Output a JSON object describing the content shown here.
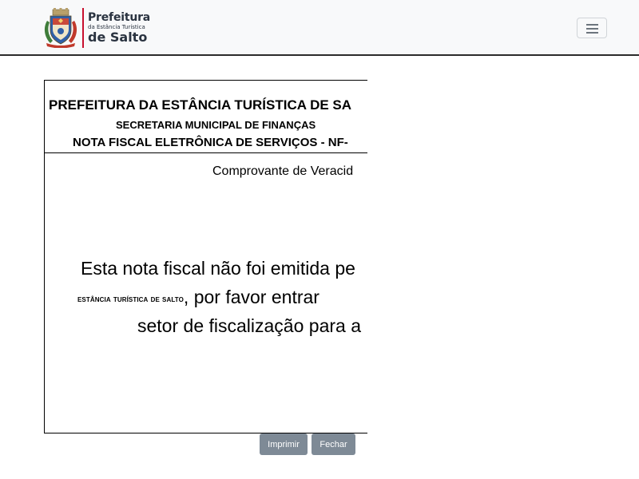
{
  "navbar": {
    "brand": {
      "line1": "Prefeitura",
      "line2": "da Estância Turística",
      "line3": "de Salto"
    },
    "toggler_icon": "hamburger-icon"
  },
  "document": {
    "header_title": "PREFEITURA DA ESTÂNCIA TURÍSTICA DE SA",
    "header_subtitle": "SECRETARIA MUNICIPAL DE FINANÇAS",
    "header_doc_type": "NOTA FISCAL ELETRÔNICA DE SERVIÇOS - NF-",
    "verification_label": "Comprovante de Veracid",
    "message": {
      "line1": "Esta nota fiscal não foi emitida pe",
      "line2_small": "estância turística de salto",
      "line2_rest": ", por favor entrar",
      "line3": "setor de fiscalização para a"
    }
  },
  "buttons": {
    "print_label": "Imprimir",
    "close_label": "Fechar"
  },
  "colors": {
    "navbar_bg": "#f8f9fa",
    "button_bg": "#7e8a96",
    "brand_accent": "#c8102e",
    "brand_text": "#2a3340"
  }
}
